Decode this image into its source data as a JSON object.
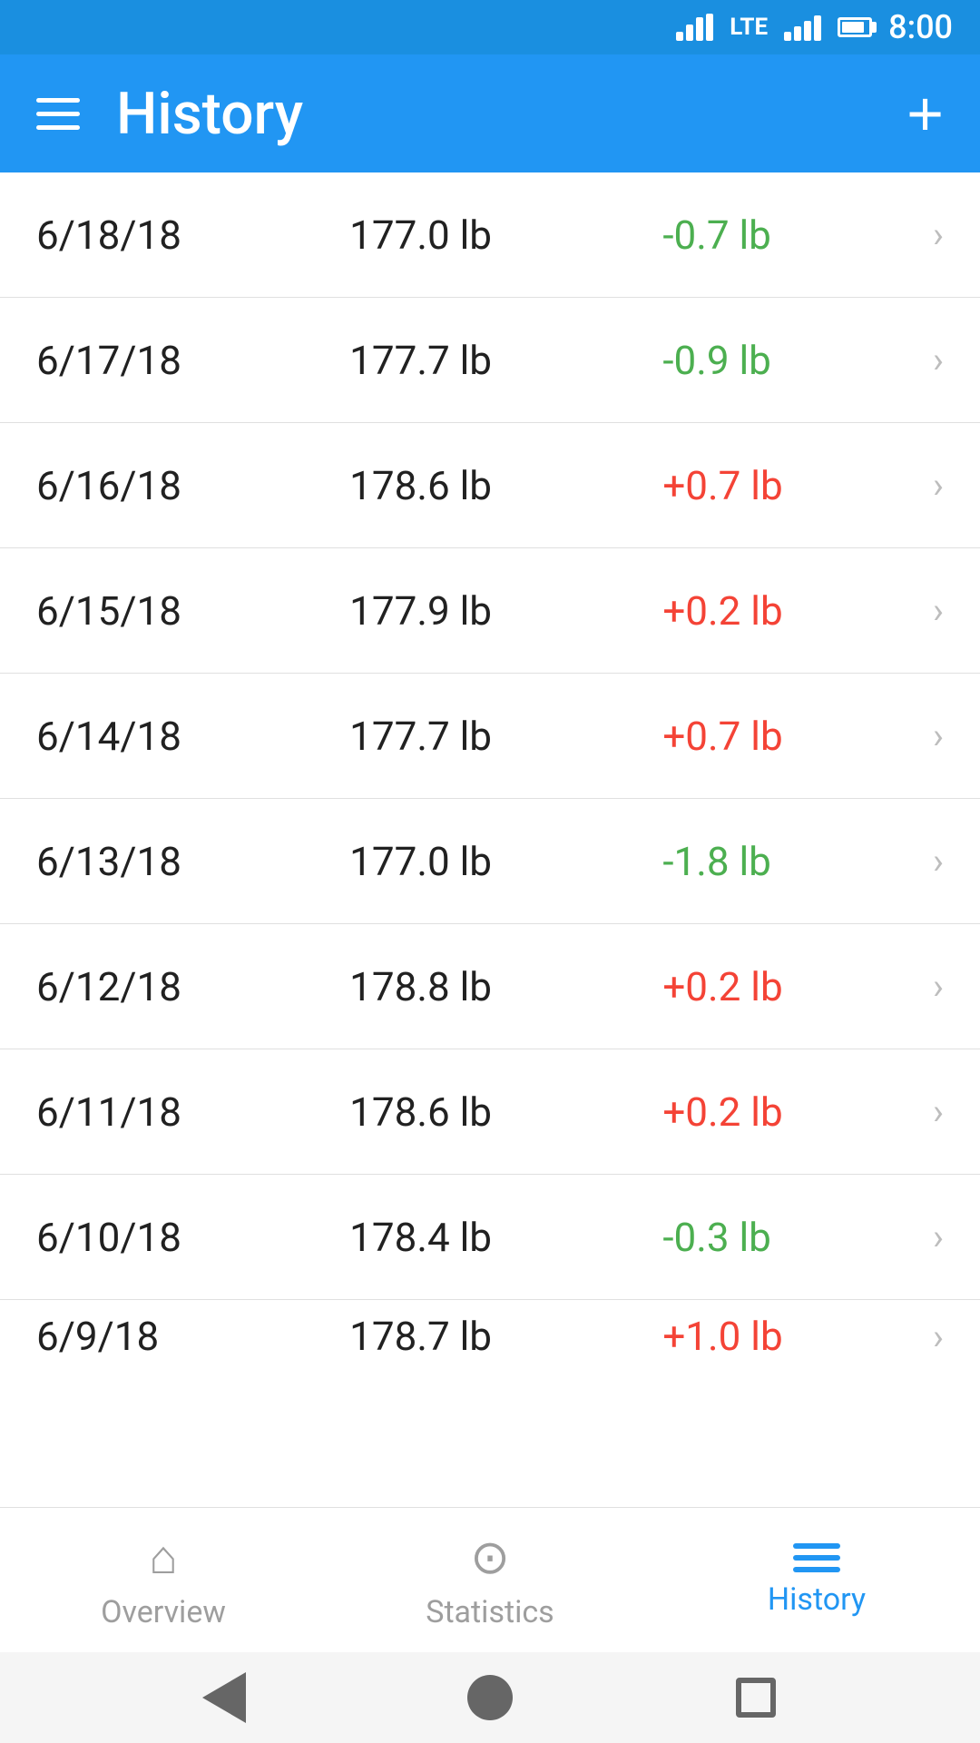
{
  "statusBar": {
    "time": "8:00",
    "wifiLabel": "wifi",
    "lte": "LTE",
    "batteryLabel": "battery"
  },
  "appBar": {
    "title": "History",
    "addButtonLabel": "+"
  },
  "entries": [
    {
      "date": "6/18/18",
      "weight": "177.0 lb",
      "change": "-0.7 lb",
      "changeType": "negative"
    },
    {
      "date": "6/17/18",
      "weight": "177.7 lb",
      "change": "-0.9 lb",
      "changeType": "negative"
    },
    {
      "date": "6/16/18",
      "weight": "178.6 lb",
      "change": "+0.7 lb",
      "changeType": "positive"
    },
    {
      "date": "6/15/18",
      "weight": "177.9 lb",
      "change": "+0.2 lb",
      "changeType": "positive"
    },
    {
      "date": "6/14/18",
      "weight": "177.7 lb",
      "change": "+0.7 lb",
      "changeType": "positive"
    },
    {
      "date": "6/13/18",
      "weight": "177.0 lb",
      "change": "-1.8 lb",
      "changeType": "negative"
    },
    {
      "date": "6/12/18",
      "weight": "178.8 lb",
      "change": "+0.2 lb",
      "changeType": "positive"
    },
    {
      "date": "6/11/18",
      "weight": "178.6 lb",
      "change": "+0.2 lb",
      "changeType": "positive"
    },
    {
      "date": "6/10/18",
      "weight": "178.4 lb",
      "change": "-0.3 lb",
      "changeType": "negative"
    },
    {
      "date": "6/9/18",
      "weight": "178.7 lb",
      "change": "+1.0 lb",
      "changeType": "positive"
    }
  ],
  "bottomNav": {
    "items": [
      {
        "id": "overview",
        "label": "Overview",
        "icon": "house",
        "active": false
      },
      {
        "id": "statistics",
        "label": "Statistics",
        "icon": "stats",
        "active": false
      },
      {
        "id": "history",
        "label": "History",
        "icon": "list",
        "active": true
      }
    ]
  },
  "colors": {
    "primary": "#2196F3",
    "negative": "#4CAF50",
    "positive": "#F44336",
    "activeNav": "#2196F3",
    "inactiveNav": "#9e9e9e"
  }
}
